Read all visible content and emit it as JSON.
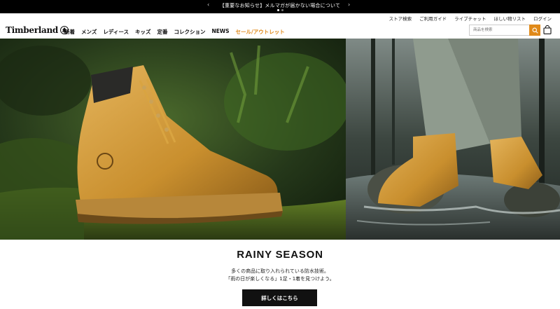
{
  "announcement": {
    "text": "【重要なお知らせ】メルマガが届かない場合について",
    "prev_icon": "chevron-left",
    "next_icon": "chevron-right",
    "slide_count": 2,
    "active_slide": 1
  },
  "utility_links": [
    "ストア検索",
    "ご利用ガイド",
    "ライブチャット",
    "ほしい物リスト",
    "ログイン"
  ],
  "brand": {
    "name": "Timberland",
    "logo_icon": "tree-logo"
  },
  "nav": {
    "items": [
      "新着",
      "メンズ",
      "レディース",
      "キッズ",
      "定番",
      "コレクション",
      "NEWS"
    ],
    "sale": "セール/アウトレット"
  },
  "search": {
    "placeholder": "商品を検索",
    "icon": "search-icon"
  },
  "cart": {
    "icon": "cart-icon"
  },
  "campaign": {
    "headline": "RAINY SEASON",
    "line1": "多くの商品に取り入れられている防水技術。",
    "line2": "「雨の日が楽しくなる」1足・1着を見つけよう。",
    "cta": "詳しくはこちら"
  },
  "colors": {
    "accent": "#e08a1a",
    "announce_bg": "#000000",
    "cta_bg": "#111111"
  }
}
